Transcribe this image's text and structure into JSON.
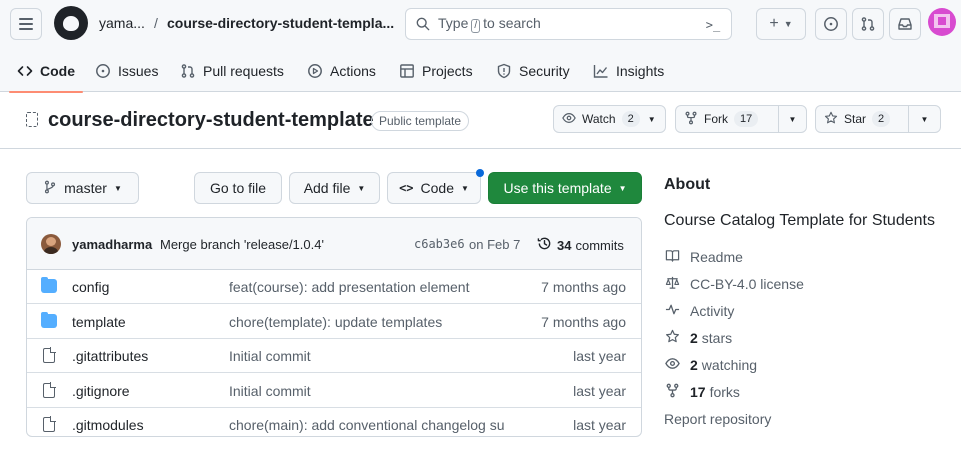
{
  "header": {
    "owner": "yama...",
    "separator": "/",
    "repo": "course-directory-student-templa...",
    "search": {
      "prefix": "Type",
      "key": "/",
      "suffix": "to search"
    },
    "command_palette_icon": ">_",
    "create_icon": "+"
  },
  "tabs": [
    {
      "label": "Code",
      "icon": "code-icon",
      "active": true
    },
    {
      "label": "Issues",
      "icon": "issue-opened-icon"
    },
    {
      "label": "Pull requests",
      "icon": "git-pull-request-icon"
    },
    {
      "label": "Actions",
      "icon": "play-icon"
    },
    {
      "label": "Projects",
      "icon": "table-icon"
    },
    {
      "label": "Security",
      "icon": "shield-icon"
    },
    {
      "label": "Insights",
      "icon": "graph-icon"
    }
  ],
  "repo": {
    "name": "course-directory-student-template",
    "visibility": "Public template",
    "watch": {
      "label": "Watch",
      "count": "2"
    },
    "fork": {
      "label": "Fork",
      "count": "17"
    },
    "star": {
      "label": "Star",
      "count": "2"
    }
  },
  "toolbar": {
    "branch": "master",
    "go_to_file": "Go to file",
    "add_file": "Add file",
    "code": "Code",
    "use_template": "Use this template"
  },
  "latest_commit": {
    "author": "yamadharma",
    "message": "Merge branch 'release/1.0.4'",
    "sha": "c6ab3e6",
    "date": "on Feb 7",
    "count": "34",
    "count_label": "commits"
  },
  "files": [
    {
      "type": "dir",
      "name": "config",
      "message": "feat(course): add presentation element",
      "age": "7 months ago"
    },
    {
      "type": "dir",
      "name": "template",
      "message": "chore(template): update templates",
      "age": "7 months ago"
    },
    {
      "type": "file",
      "name": ".gitattributes",
      "message": "Initial commit",
      "age": "last year"
    },
    {
      "type": "file",
      "name": ".gitignore",
      "message": "Initial commit",
      "age": "last year"
    },
    {
      "type": "file",
      "name": ".gitmodules",
      "message": "chore(main): add conventional changelog su",
      "age": "last year"
    }
  ],
  "about": {
    "title": "About",
    "description": "Course Catalog Template for Students",
    "readme": "Readme",
    "license": "CC-BY-4.0 license",
    "activity": "Activity",
    "stars_count": "2",
    "stars_label": "stars",
    "watching_count": "2",
    "watching_label": "watching",
    "forks_count": "17",
    "forks_label": "forks",
    "report": "Report repository"
  },
  "colors": {
    "primary_button": "#1f883d",
    "accent_underline": "#fd8c73",
    "folder": "#54aeff",
    "link_dot": "#0969da"
  }
}
